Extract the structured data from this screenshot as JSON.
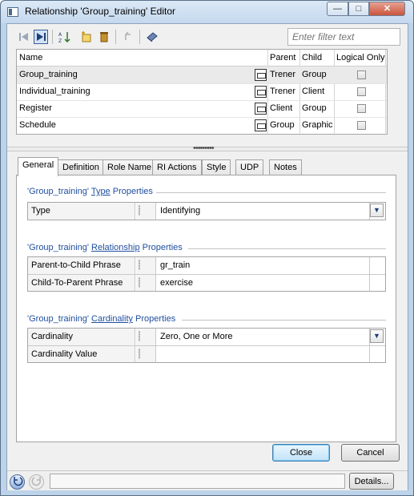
{
  "window": {
    "title": "Relationship 'Group_training' Editor",
    "min_glyph": "—",
    "max_glyph": "□",
    "close_glyph": "✕"
  },
  "toolbar": {
    "filter_placeholder": "Enter filter text",
    "icons": [
      "move-first-icon",
      "move-next-icon",
      "sort-icon",
      "new-icon",
      "delete-icon",
      "undo-icon",
      "properties-icon"
    ]
  },
  "grid": {
    "columns": [
      "Name",
      "Parent",
      "Child",
      "Logical Only"
    ],
    "rows": [
      {
        "name": "Group_training",
        "parent": "Trener",
        "child": "Group",
        "logical_only": false
      },
      {
        "name": "Individual_training",
        "parent": "Trener",
        "child": "Client",
        "logical_only": false
      },
      {
        "name": "Register",
        "parent": "Client",
        "child": "Group",
        "logical_only": false
      },
      {
        "name": "Schedule",
        "parent": "Group",
        "child": "Graphic",
        "logical_only": false
      }
    ]
  },
  "tabs": [
    "General",
    "Definition",
    "Role Name",
    "RI Actions",
    "Style",
    "UDP",
    "Notes"
  ],
  "active_tab": "General",
  "sections": {
    "type": {
      "title_prefix": "'Group_training' ",
      "title_link": "Type",
      "title_suffix": " Properties",
      "rows": [
        {
          "label": "Type",
          "value": "Identifying",
          "dropdown": true
        }
      ]
    },
    "relationship": {
      "title_prefix": "'Group_training' ",
      "title_link": "Relationship",
      "title_suffix": " Properties",
      "rows": [
        {
          "label": "Parent-to-Child Phrase",
          "value": "gr_train"
        },
        {
          "label": "Child-To-Parent Phrase",
          "value": "exercise"
        }
      ]
    },
    "cardinality": {
      "title_prefix": "'Group_training' ",
      "title_link": "Cardinality",
      "title_suffix": " Properties",
      "rows": [
        {
          "label": "Cardinality",
          "value": "Zero, One or More",
          "dropdown": true
        },
        {
          "label": "Cardinality Value",
          "value": ""
        }
      ]
    }
  },
  "buttons": {
    "close": "Close",
    "cancel": "Cancel",
    "details": "Details..."
  },
  "colors": {
    "section_title": "#1e4e9e",
    "frame": "#bcd3ea"
  }
}
